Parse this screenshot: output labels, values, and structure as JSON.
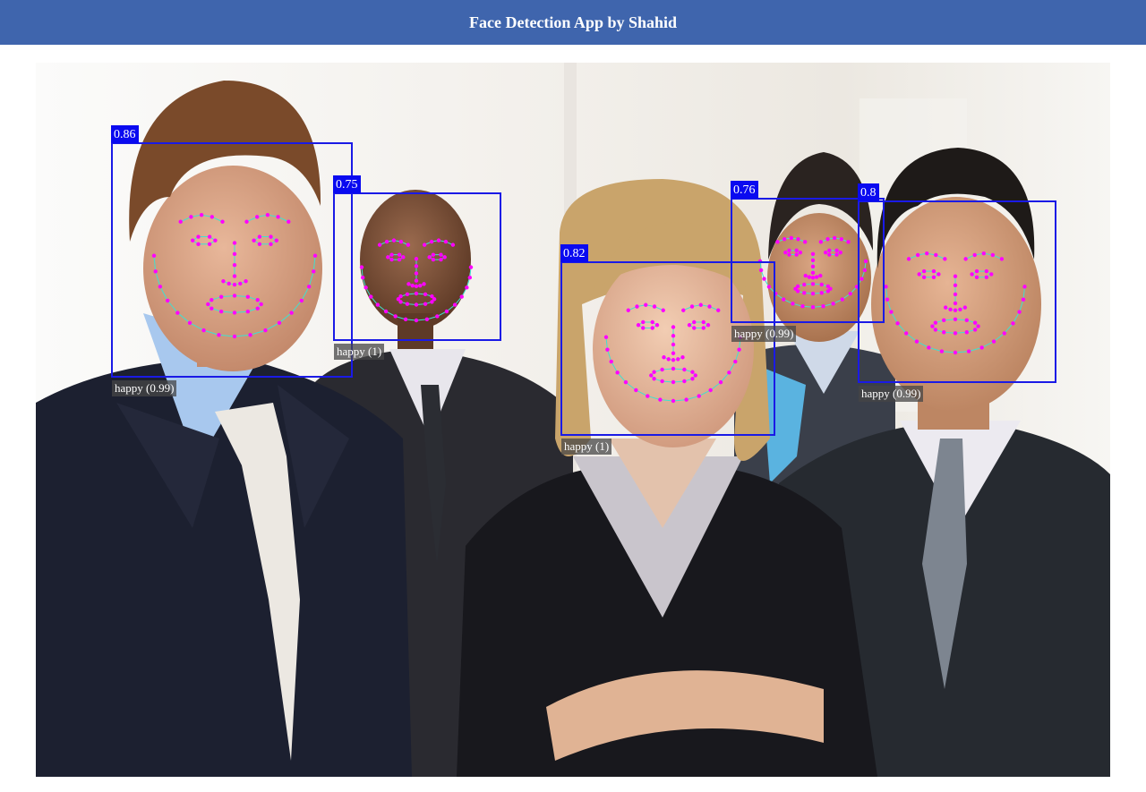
{
  "header": {
    "title": "Face Detection App by Shahid"
  },
  "colors": {
    "header_bg": "#3f65ad",
    "box": "#1a1ae6",
    "score_bg": "#0a0af0",
    "landmark_point": "#ff00ff",
    "landmark_line": "#40e0d0"
  },
  "faces": [
    {
      "score": "0.86",
      "expression": "happy (0.99)"
    },
    {
      "score": "0.75",
      "expression": "happy (1)"
    },
    {
      "score": "0.82",
      "expression": "happy (1)"
    },
    {
      "score": "0.76",
      "expression": "happy (0.99)"
    },
    {
      "score": "0.8",
      "expression": "happy (0.99)"
    }
  ]
}
